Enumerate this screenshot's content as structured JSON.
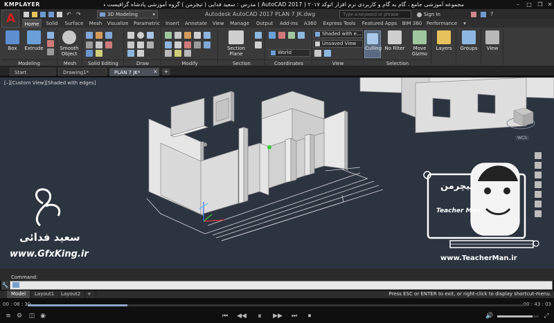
{
  "player": {
    "logo": "KMPLAYER",
    "title": "مجموعه آموزشی جامع ، گام به گام و کاربردی نرم افزار   اتوکد ۲۰۱۷ ( AutoCAD 2017 )   مدرس : سعید فدایی ( تیچرمن ) گروه آموزشی پادشاه گرافیست ها",
    "controls": [
      "⏮",
      "◀◀",
      "⏸",
      "▶▶",
      "⏭",
      "⏹"
    ],
    "time_current": "00 : 08 : 30",
    "time_total": "00 : 43 : 03",
    "progress_fraction": 0.2,
    "volume_fraction": 0.85
  },
  "autocad": {
    "app_letter": "A",
    "workspace": "3D Modeling",
    "doc_title": "Autodesk AutoCAD 2017    PLAN 7 JK.dwg",
    "search_placeholder": "Type a keyword or phrase",
    "signin": "Sign In",
    "ribbon_tabs": [
      "Home",
      "Solid",
      "Surface",
      "Mesh",
      "Visualize",
      "Parametric",
      "Insert",
      "Annotate",
      "View",
      "Manage",
      "Output",
      "Add-ins",
      "A360",
      "Express Tools",
      "Featured Apps",
      "BIM 360",
      "Performance"
    ],
    "ribbon": {
      "box": "Box",
      "extrude": "Extrude",
      "smooth_object": "Smooth\nObject",
      "section_plane": "Section\nPlane",
      "culling": "Culling",
      "no_filter": "No Filter",
      "move_gizmo": "Move\nGizmo",
      "layers": "Layers",
      "groups": "Groups",
      "view": "View",
      "visual_style": "Shaded with e...",
      "saved_view": "Unsaved View",
      "ucs": "World"
    },
    "panels": [
      "Modeling",
      "Mesh",
      "Solid Editing",
      "Draw",
      "Modify",
      "Section",
      "Coordinates",
      "View",
      "Selection"
    ],
    "file_tabs": [
      "Start",
      "Drawing1*",
      "PLAN 7 JK*"
    ],
    "viewport_label": "[–][Custom View][Shaded with edges]",
    "viewcube_label": "WCS",
    "command_label": "Command:",
    "layout_tabs": [
      "Model",
      "Layout1",
      "Layout2"
    ],
    "status_message": "Press ESC or ENTER to exit, or right-click to display shortcut-menu."
  },
  "watermarks": {
    "left_name": "سعید فدائی",
    "left_site": "www.GfxKing.ir",
    "right_brand": "تیچرمن",
    "right_sub": "Teacher Man",
    "right_site": "www.TeacherMan.ir"
  },
  "colors": {
    "viewport_bg": "#2c3440",
    "ribbon_bg": "#3a3a3a",
    "wall": "#dcdcdc",
    "accent_blue": "#7aa0cf"
  }
}
